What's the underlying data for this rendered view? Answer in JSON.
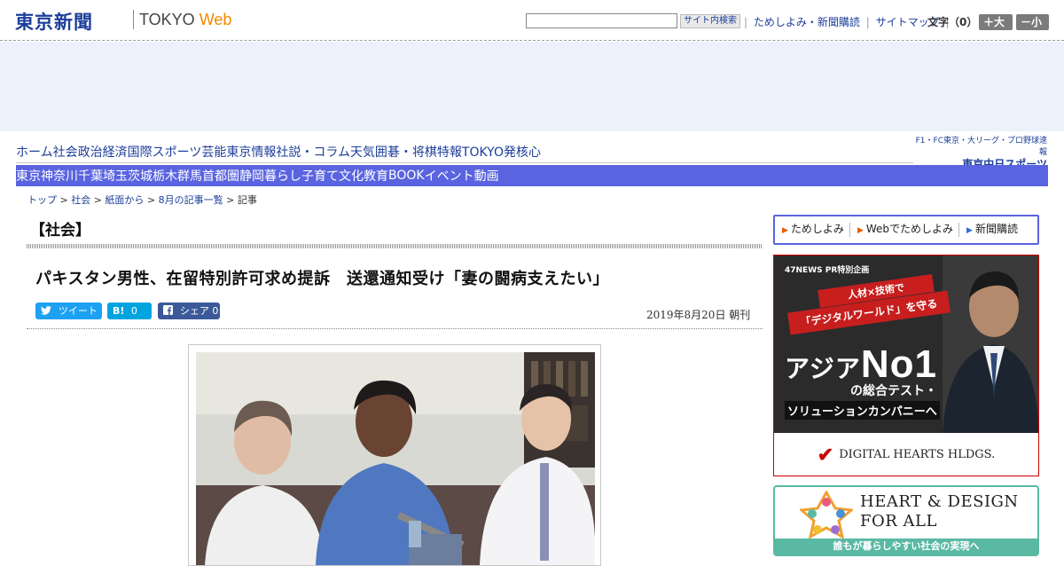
{
  "header": {
    "logo": "東京新聞",
    "logo_sub_text": "TOKYO",
    "logo_sub_accent": "Web",
    "search": {
      "placeholder": "",
      "button": "サイト内検索"
    },
    "util_links": [
      "ためしよみ・新聞購読",
      "サイトマップ"
    ],
    "font_size_label": "文字（0）",
    "font_up": "＋大",
    "font_down": "－小"
  },
  "nav_primary": [
    "ホーム",
    "社会",
    "政治",
    "経済",
    "国際",
    "スポーツ",
    "芸能",
    "東京情報",
    "社説・コラム",
    "天気",
    "囲碁・将棋",
    "特報",
    "TOKYO発",
    "核心"
  ],
  "nav_ad": {
    "line1": "F1・FC東京・大リーグ・プロ野球速報",
    "line2": "東京中日スポーツ"
  },
  "nav_regional": [
    "東京",
    "神奈川",
    "千葉",
    "埼玉",
    "茨城",
    "栃木",
    "群馬",
    "首都圏",
    "静岡",
    "暮らし",
    "子育て",
    "文化",
    "教育",
    "BOOK",
    "イベント",
    "動画"
  ],
  "breadcrumb": {
    "items": [
      "トップ",
      "社会",
      "紙面から",
      "8月の記事一覧"
    ],
    "current": "記事",
    "separator": ">"
  },
  "article": {
    "section": "【社会】",
    "headline": "パキスタン男性、在留特別許可求め提訴　送還通知受け「妻の闘病支えたい」",
    "date": "2019年8月20日 朝刊",
    "share": {
      "tweet_label": "ツイート",
      "hatena_label": "B!",
      "hatena_count": "0",
      "facebook_label": "シェア",
      "facebook_count": "0"
    }
  },
  "sidebar": {
    "subscribe": [
      "ためしよみ",
      "Webでためしよみ",
      "新聞購読"
    ],
    "ad": {
      "kicker": "47NEWS PR特別企画",
      "tag1": "人材×技術で",
      "tag2": "「デジタルワールド」を守る",
      "big_a": "アジア",
      "big_b": "No1",
      "line2": "の総合テスト・",
      "line3": "ソリューションカンパニーへ",
      "company": "DIGITAL HEARTS HLDGS."
    },
    "hd_banner": {
      "title_line1": "HEART & DESIGN",
      "title_line2": "FOR ALL",
      "caption": "誰もが暮らしやすい社会の実現へ"
    }
  },
  "colors": {
    "brand": "#1d3e9a",
    "nav_bar": "#5a64e0",
    "accent_orange": "#f08a00",
    "twitter": "#1da1f2",
    "hatena": "#00a4de",
    "facebook": "#3b5998"
  }
}
